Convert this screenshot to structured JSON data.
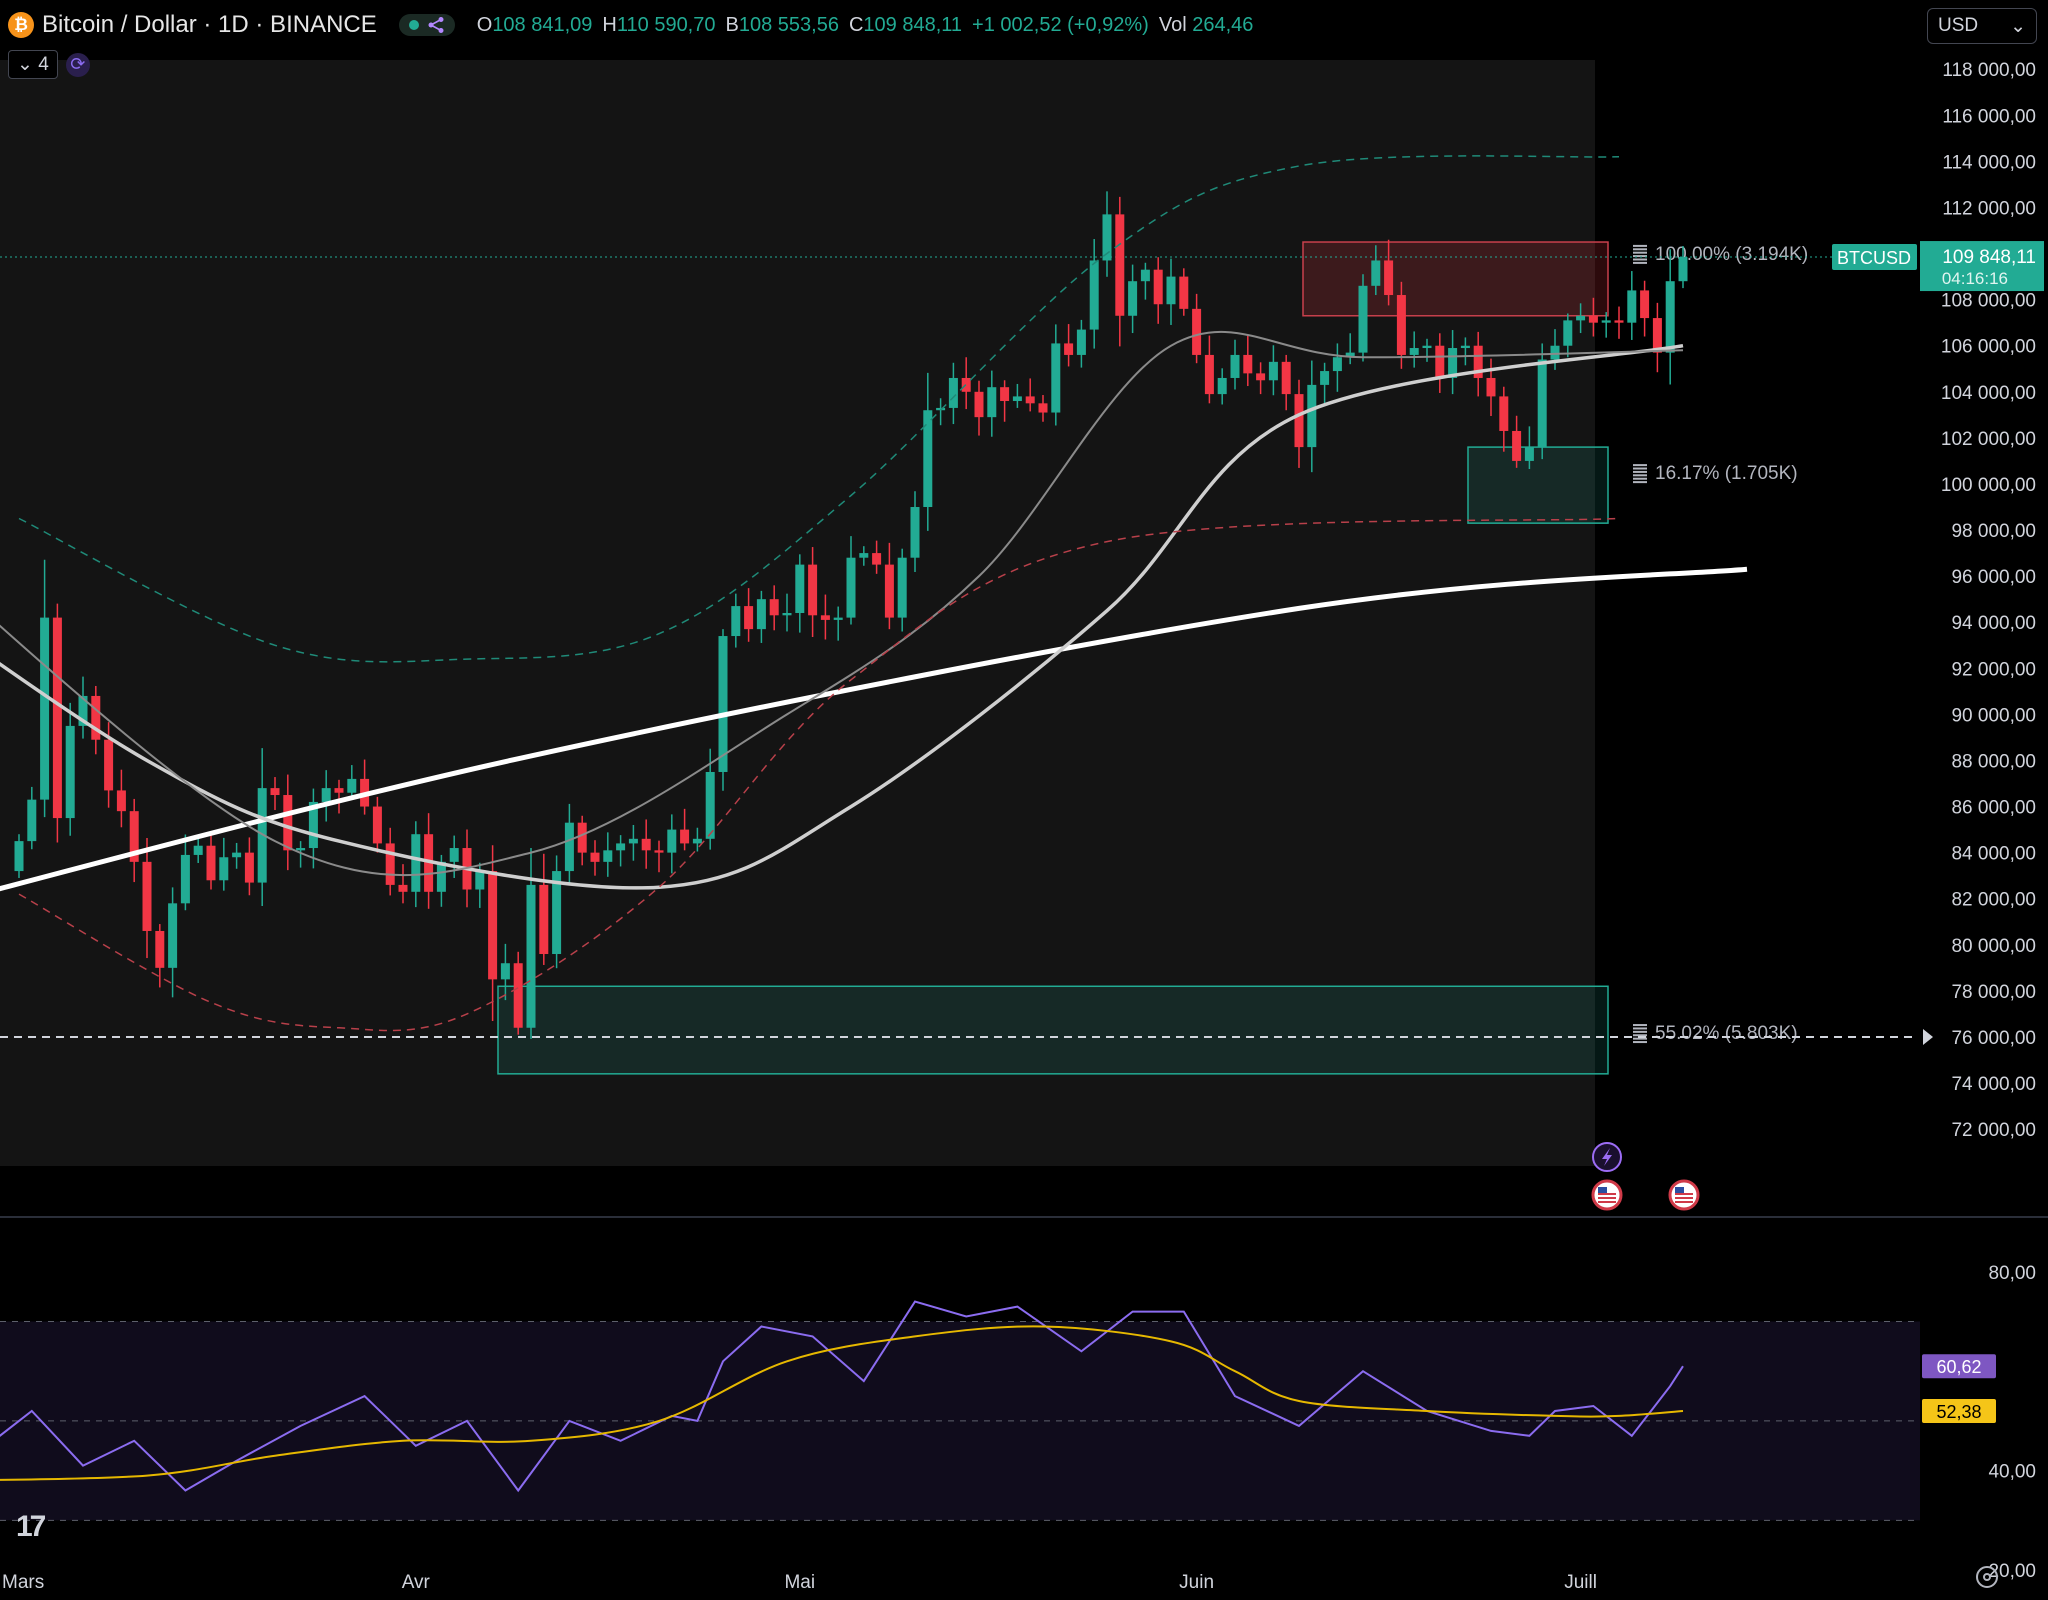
{
  "header": {
    "coin_glyph": "₿",
    "title": "Bitcoin / Dollar · 1D · BINANCE",
    "ohlc": [
      {
        "label": "O",
        "value": "108 841,09"
      },
      {
        "label": "H",
        "value": "110 590,70"
      },
      {
        "label": "B",
        "value": "108 553,56"
      },
      {
        "label": "C",
        "value": "109 848,11"
      }
    ],
    "change": "+1 002,52 (+0,92%)",
    "vol_label": "Vol",
    "vol_value": "264,46"
  },
  "indicators_button": {
    "label": "4"
  },
  "currency": {
    "value": "USD"
  },
  "chart_data": [
    {
      "type": "candlestick",
      "symbol": "BTCUSD",
      "interval": "1D",
      "x_tick_labels": [
        "Mars",
        "Avr",
        "Mai",
        "Juin",
        "Juill"
      ],
      "x_tick_day_index": [
        0,
        31,
        61,
        92,
        122
      ],
      "y_ticks": [
        72000,
        74000,
        76000,
        78000,
        80000,
        82000,
        84000,
        86000,
        88000,
        90000,
        92000,
        94000,
        96000,
        98000,
        100000,
        102000,
        104000,
        106000,
        108000,
        110000,
        112000,
        114000,
        116000,
        118000
      ],
      "y_tick_labels": [
        "72 000,00",
        "74 000,00",
        "76 000,00",
        "78 000,00",
        "80 000,00",
        "82 000,00",
        "84 000,00",
        "86 000,00",
        "88 000,00",
        "90 000,00",
        "92 000,00",
        "94 000,00",
        "96 000,00",
        "98 000,00",
        "100 000,00",
        "102 000,00",
        "104 000,00",
        "106 000,00",
        "108 000,00",
        "",
        "112 000,00",
        "114 000,00",
        "116 000,00",
        "118 000,00"
      ],
      "ylim": [
        70400,
        118400
      ],
      "closes": [
        84500,
        86300,
        94200,
        85500,
        89500,
        90800,
        88900,
        86700,
        85800,
        83600,
        80600,
        79000,
        81800,
        83900,
        84300,
        82800,
        83800,
        84000,
        82700,
        86800,
        86500,
        84100,
        84200,
        86200,
        86800,
        86600,
        87200,
        86000,
        84400,
        82600,
        82300,
        84800,
        82300,
        83600,
        84200,
        82400,
        83200,
        78500,
        79200,
        76400,
        82600,
        79600,
        83200,
        85300,
        84000,
        83600,
        84100,
        84400,
        84600,
        84100,
        84000,
        85000,
        84400,
        84600,
        87500,
        93400,
        94700,
        93700,
        95000,
        94300,
        94400,
        96500,
        94300,
        94100,
        94200,
        96800,
        97000,
        96500,
        94200,
        96800,
        99000,
        103200,
        103300,
        104600,
        104000,
        102900,
        104200,
        103600,
        103800,
        103500,
        103100,
        106100,
        105600,
        106700,
        109700,
        111700,
        107300,
        108800,
        109300,
        107800,
        109000,
        107600,
        105600,
        103900,
        104600,
        105600,
        104800,
        104500,
        105300,
        103900,
        101600,
        104300,
        104900,
        105500,
        105700,
        108600,
        109700,
        108200,
        105600,
        105900,
        106000,
        104600,
        105900,
        106000,
        104600,
        103800,
        102300,
        101000,
        101600,
        105400,
        106000,
        107100,
        107300,
        107000,
        107100,
        107000,
        108400,
        107200,
        105700,
        108800,
        109848
      ],
      "series": [
        {
          "name": "MA 200",
          "points": [
            [
              -10,
              81200
            ],
            [
              40,
              88200
            ],
            [
              100,
              94600
            ],
            [
              135,
              96300
            ]
          ]
        },
        {
          "name": "MA 50",
          "points": [
            [
              -10,
              95500
            ],
            [
              10,
              88000
            ],
            [
              25,
              84500
            ],
            [
              50,
              82500
            ],
            [
              65,
              86000
            ],
            [
              85,
              94500
            ],
            [
              100,
              103000
            ],
            [
              130,
              106000
            ]
          ]
        },
        {
          "name": "MA 20",
          "points": [
            [
              -10,
              98000
            ],
            [
              20,
              84500
            ],
            [
              40,
              84000
            ],
            [
              60,
              90000
            ],
            [
              75,
              96000
            ],
            [
              90,
              106000
            ],
            [
              105,
              105500
            ],
            [
              130,
              105800
            ]
          ]
        }
      ],
      "zones": [
        {
          "label": "100.00% (3.194K)",
          "low": 107300,
          "high": 110500,
          "role": "resistance"
        },
        {
          "label": "16.17% (1.705K)",
          "low": 98300,
          "high": 101600,
          "role": "support"
        },
        {
          "label": "55.02% (5.803K)",
          "low": 74400,
          "high": 78200,
          "role": "support"
        }
      ],
      "dashed_level": 76000,
      "last_price": {
        "symbol": "BTCUSD",
        "value": "109 848,11",
        "countdown": "04:16:16"
      },
      "events": [
        "lightning-icon",
        "us-flag-icon",
        "us-flag-icon"
      ]
    },
    {
      "type": "line",
      "name": "RSI",
      "y_ticks": [
        20,
        40,
        60,
        80
      ],
      "y_tick_labels": [
        "20,00",
        "40,00",
        "",
        "80,00"
      ],
      "ylim": [
        19,
        87
      ],
      "band": [
        30,
        70
      ],
      "midline": 50,
      "rsi_points": [
        [
          -5,
          40
        ],
        [
          1,
          52
        ],
        [
          5,
          41
        ],
        [
          9,
          46
        ],
        [
          13,
          36
        ],
        [
          17,
          42
        ],
        [
          22,
          49
        ],
        [
          27,
          55
        ],
        [
          31,
          45
        ],
        [
          35,
          50
        ],
        [
          39,
          36
        ],
        [
          43,
          50
        ],
        [
          47,
          46
        ],
        [
          51,
          51
        ],
        [
          53,
          50
        ],
        [
          55,
          62
        ],
        [
          58,
          69
        ],
        [
          62,
          67
        ],
        [
          66,
          58
        ],
        [
          70,
          74
        ],
        [
          74,
          71
        ],
        [
          78,
          73
        ],
        [
          83,
          64
        ],
        [
          87,
          72
        ],
        [
          91,
          72
        ],
        [
          95,
          55
        ],
        [
          100,
          49
        ],
        [
          105,
          60
        ],
        [
          110,
          52
        ],
        [
          115,
          48
        ],
        [
          118,
          47
        ],
        [
          120,
          52
        ],
        [
          123,
          53
        ],
        [
          126,
          47
        ],
        [
          129,
          57
        ],
        [
          130,
          61
        ]
      ],
      "signal_points": [
        [
          -5,
          38
        ],
        [
          10,
          39
        ],
        [
          20,
          43
        ],
        [
          30,
          46
        ],
        [
          40,
          46
        ],
        [
          50,
          50
        ],
        [
          60,
          62
        ],
        [
          70,
          67
        ],
        [
          80,
          69
        ],
        [
          90,
          66
        ],
        [
          95,
          60
        ],
        [
          100,
          54
        ],
        [
          110,
          52
        ],
        [
          120,
          51
        ],
        [
          125,
          51
        ],
        [
          130,
          52
        ]
      ],
      "labels": {
        "rsi": "60,62",
        "signal": "52,38"
      }
    }
  ]
}
